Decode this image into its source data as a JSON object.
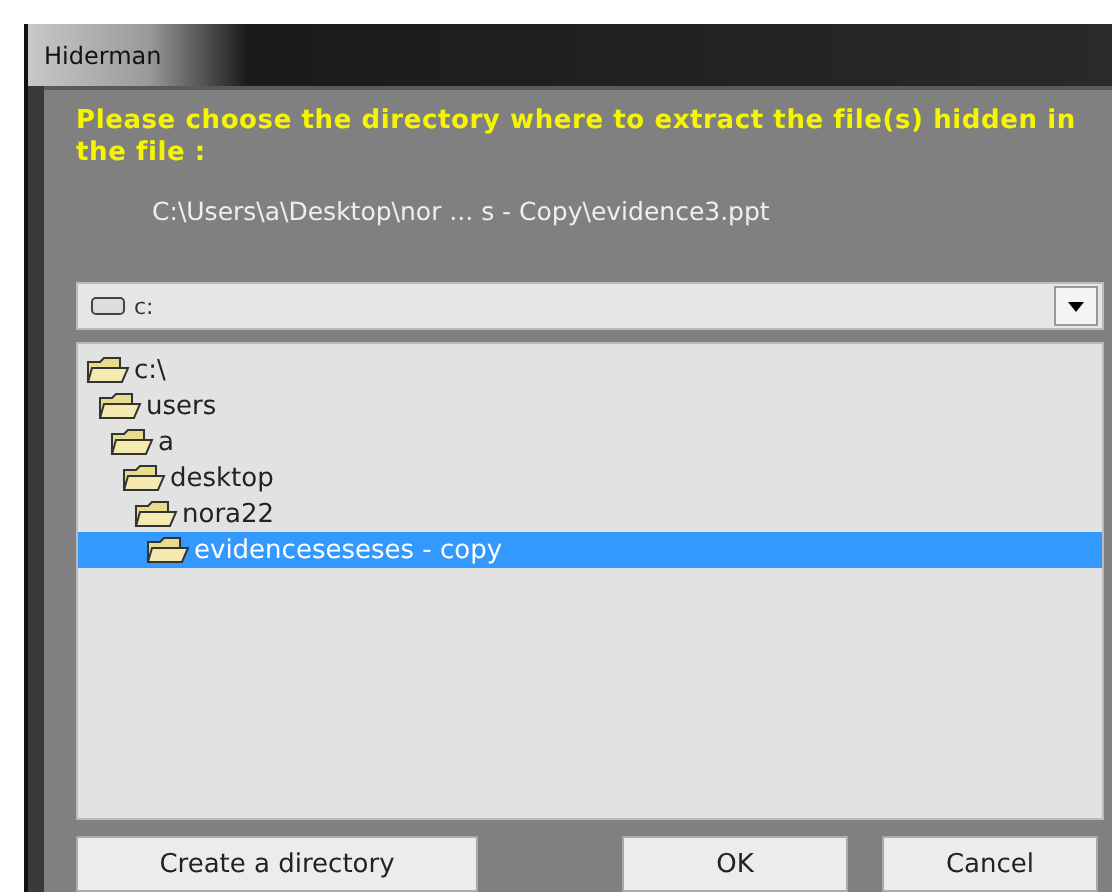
{
  "window": {
    "title": "Hiderman"
  },
  "prompt": "Please choose the directory where to extract the file(s) hidden in the file :",
  "file_path": "C:\\Users\\a\\Desktop\\nor ... s - Copy\\evidence3.ppt",
  "drive_select": {
    "value": "c:"
  },
  "tree": [
    {
      "label": "c:\\",
      "selected": false,
      "children": [
        {
          "label": "users",
          "selected": false,
          "children": [
            {
              "label": "a",
              "selected": false,
              "children": [
                {
                  "label": "desktop",
                  "selected": false,
                  "children": [
                    {
                      "label": "nora22",
                      "selected": false,
                      "children": [
                        {
                          "label": "evidenceseseses - copy",
                          "selected": true
                        }
                      ]
                    }
                  ]
                }
              ]
            }
          ]
        }
      ]
    }
  ],
  "buttons": [
    {
      "kind": "create",
      "label": "Create a directory"
    },
    {
      "kind": "ok",
      "label": "OK"
    },
    {
      "kind": "cancel",
      "label": "Cancel"
    }
  ]
}
